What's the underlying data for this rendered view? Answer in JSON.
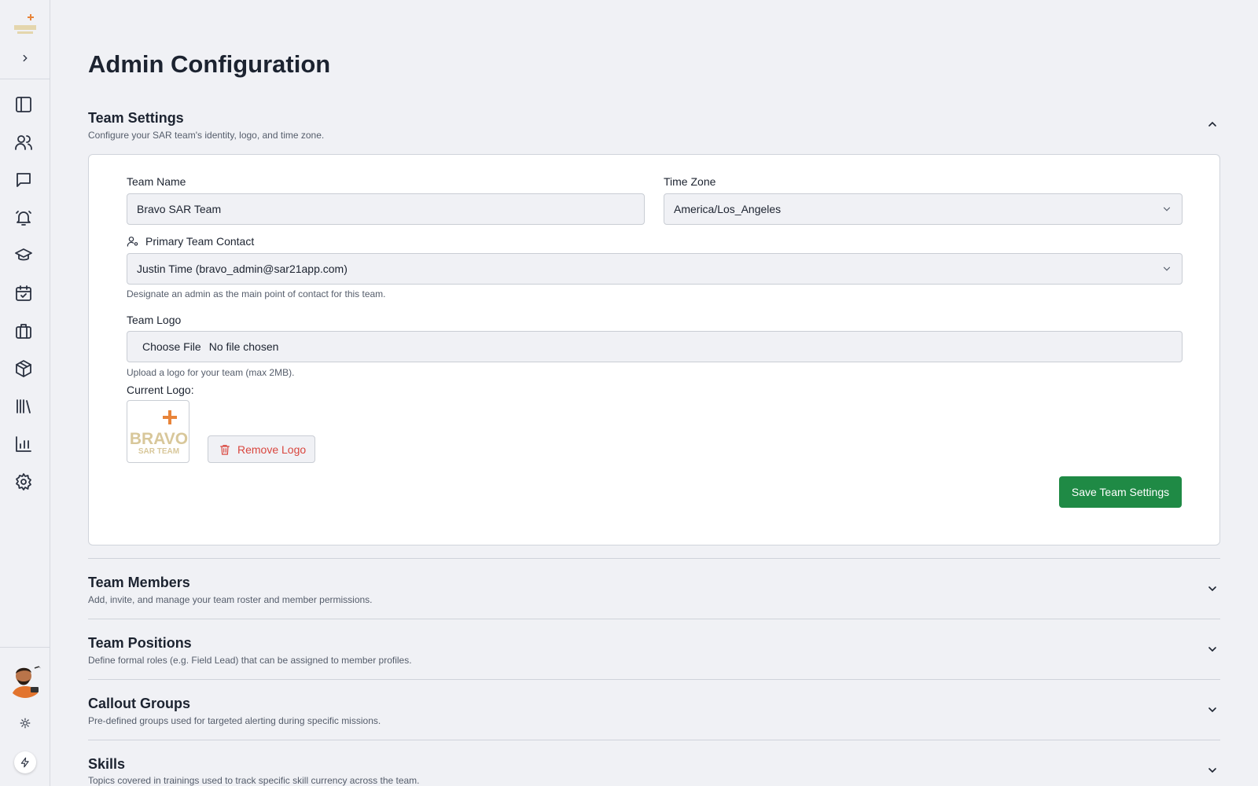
{
  "page": {
    "title": "Admin Configuration"
  },
  "sidebar": {
    "logo_text": "BRAVO SAR TEAM",
    "items": [
      {
        "icon": "sidebar-panel-icon"
      },
      {
        "icon": "users-icon"
      },
      {
        "icon": "chat-icon"
      },
      {
        "icon": "bell-icon"
      },
      {
        "icon": "graduation-cap-icon"
      },
      {
        "icon": "calendar-check-icon"
      },
      {
        "icon": "briefcase-icon"
      },
      {
        "icon": "package-icon"
      },
      {
        "icon": "library-icon"
      },
      {
        "icon": "bar-chart-icon"
      },
      {
        "icon": "gear-icon"
      }
    ]
  },
  "team_settings": {
    "title": "Team Settings",
    "description": "Configure your SAR team's identity, logo, and time zone.",
    "team_name_label": "Team Name",
    "team_name_value": "Bravo SAR Team",
    "time_zone_label": "Time Zone",
    "time_zone_value": "America/Los_Angeles",
    "contact_label": "Primary Team Contact",
    "contact_value": "Justin Time (bravo_admin@sar21app.com)",
    "contact_help": "Designate an admin as the main point of contact for this team.",
    "logo_label": "Team Logo",
    "choose_file": "Choose File",
    "no_file": "No file chosen",
    "logo_help": "Upload a logo for your team (max 2MB).",
    "current_logo_label": "Current Logo:",
    "logo_line1": "BRAVO",
    "logo_line2": "SAR TEAM",
    "remove_logo": "Remove Logo",
    "save": "Save Team Settings"
  },
  "sections": [
    {
      "title": "Team Members",
      "description": "Add, invite, and manage your team roster and member permissions."
    },
    {
      "title": "Team Positions",
      "description": "Define formal roles (e.g. Field Lead) that can be assigned to member profiles."
    },
    {
      "title": "Callout Groups",
      "description": "Pre-defined groups used for targeted alerting during specific missions."
    },
    {
      "title": "Skills",
      "description": "Topics covered in trainings used to track specific skill currency across the team."
    }
  ],
  "colors": {
    "accent": "#1f8a45",
    "danger": "#d9463e",
    "logo_orange": "#e8843a",
    "logo_tan": "#d8c79a"
  }
}
